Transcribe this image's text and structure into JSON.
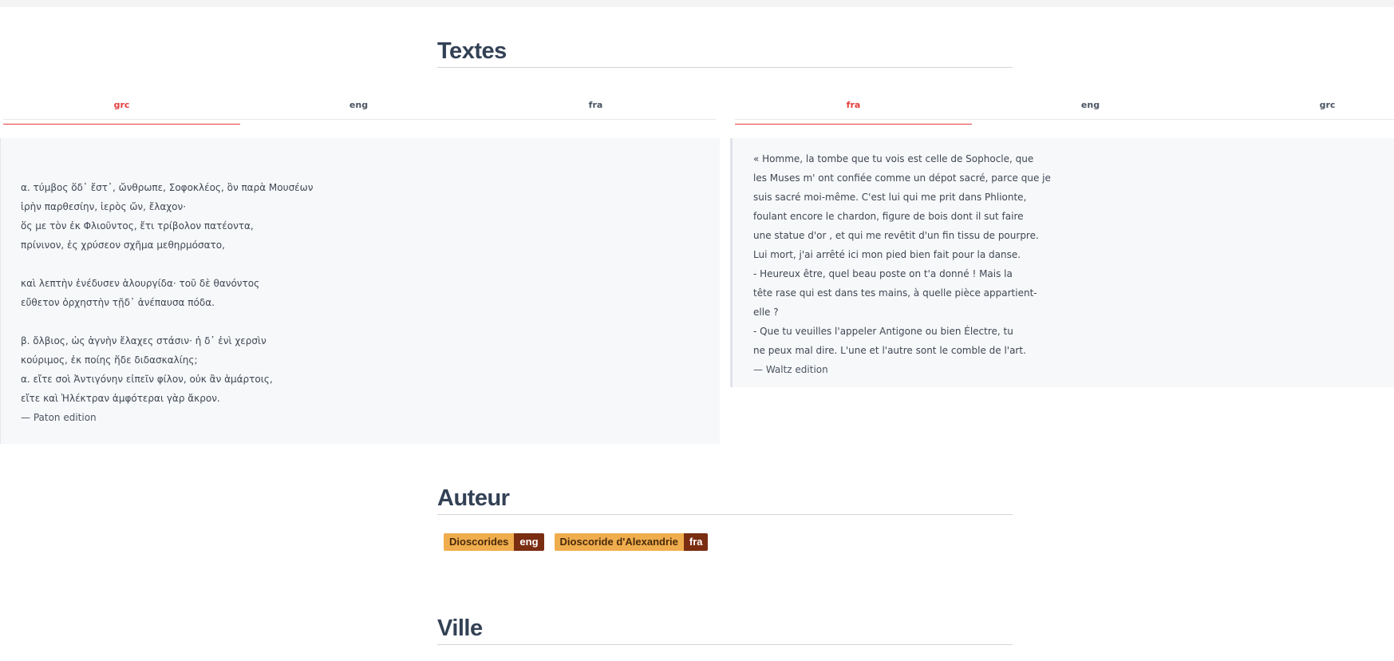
{
  "sections": {
    "textes": "Textes",
    "auteur": "Auteur",
    "ville": "Ville"
  },
  "left_tabs": [
    "grc",
    "eng",
    "fra"
  ],
  "right_tabs": [
    "fra",
    "eng",
    "grc"
  ],
  "greek_text": [
    "α. τύμβος ὅδ᾽ ἔστ᾽, ὤνθρωπε, Σοφοκλέος, ὃν παρὰ Μουσέων",
    "ἱρὴν παρθεσίην, ἱερὸς ὤν, ἔλαχον·",
    "ὅς με τὸν ἐκ Φλιοῦντος, ἔτι τρίβολον πατέοντα,",
    "πρίνινον, ἐς χρύσεον σχῆμα μεθηρμόσατο,",
    "",
    "καὶ λεπτὴν ἐνέδυσεν ἁλουργίδα· τοῦ δὲ θανόντος",
    "εὔθετον ὀρχηστὴν τῇδ᾽ ἀνέπαυσα πόδα.",
    "",
    "β. ὄλβιος, ὡς ἁγνὴν ἔλαχες στάσιν· ἡ δ᾽ ἐνὶ χερσὶν",
    "κούριμος, ἐκ ποίης ἥδε διδασκαλίης;",
    "α. εἴτε σοὶ Ἀντιγόνην εἰπεῖν φίλον, οὐκ ἂν ἁμάρτοις,",
    "εἴτε καὶ Ἠλέκτραν ἀμφότεραι γὰρ ἄκρον."
  ],
  "greek_attribution": "— Paton edition",
  "french_text": [
    "« Homme, la tombe que tu vois est celle de Sophocle, que",
    "les Muses m' ont confiée comme un dépot sacré, parce que je",
    "suis sacré moi-même. C'est lui qui me prit dans Phlionte,",
    "foulant encore le chardon, figure de bois dont il sut faire",
    "une statue d'or , et qui me revêtit d'un fin tissu de pourpre.",
    "Lui mort, j'ai arrêté ici mon pied bien fait pour la danse.",
    "- Heureux être, quel beau poste on t'a donné ! Mais la",
    "tête rase qui est dans tes mains, à quelle pièce appartient-",
    "elle ?",
    "- Que tu veuilles l'appeler Antigone ou bien Électre, tu",
    "ne peux mal dire. L'une et l'autre sont le comble de l'art."
  ],
  "french_attribution": "— Waltz edition",
  "authors": [
    {
      "name": "Dioscorides",
      "lang": "eng"
    },
    {
      "name": "Dioscoride d'Alexandrie",
      "lang": "fra"
    }
  ],
  "colors": {
    "accent": "#e53e3e",
    "badge_name_bg": "#f0ad4e",
    "badge_lang_bg": "#7b2d12"
  }
}
